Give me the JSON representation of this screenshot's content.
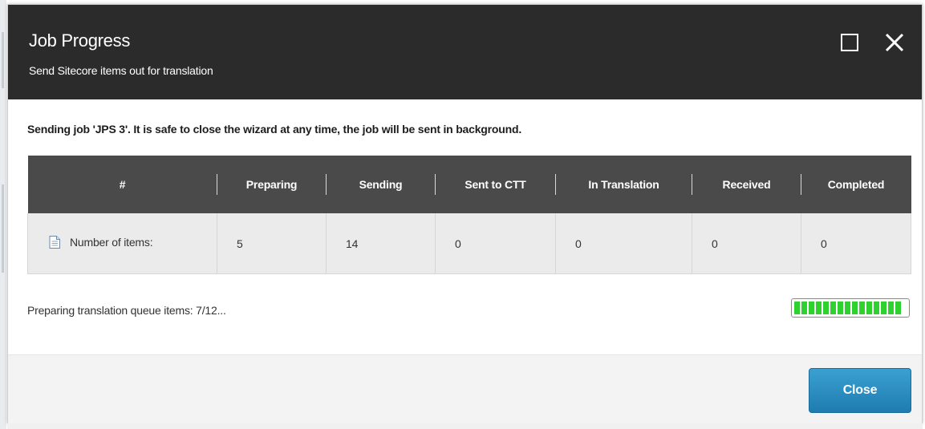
{
  "dialog": {
    "title": "Job Progress",
    "subtitle": "Send Sitecore items out for translation",
    "maximize_icon": "maximize-icon",
    "close_icon": "close-icon"
  },
  "message": "Sending job 'JPS 3'. It is safe to close the wizard at any time, the job will be sent in background.",
  "table": {
    "headers": [
      "#",
      "Preparing",
      "Sending",
      "Sent to CTT",
      "In Translation",
      "Received",
      "Completed"
    ],
    "row": {
      "label": "Number of items:",
      "icon": "document-icon",
      "values": [
        "5",
        "14",
        "0",
        "0",
        "0",
        "0"
      ]
    }
  },
  "progress": {
    "text": "Preparing translation queue items: 7/12...",
    "fill_fraction": 0.96,
    "color": "#2fd12f"
  },
  "footer": {
    "close_label": "Close",
    "accent_color": "#1f7cb0"
  }
}
